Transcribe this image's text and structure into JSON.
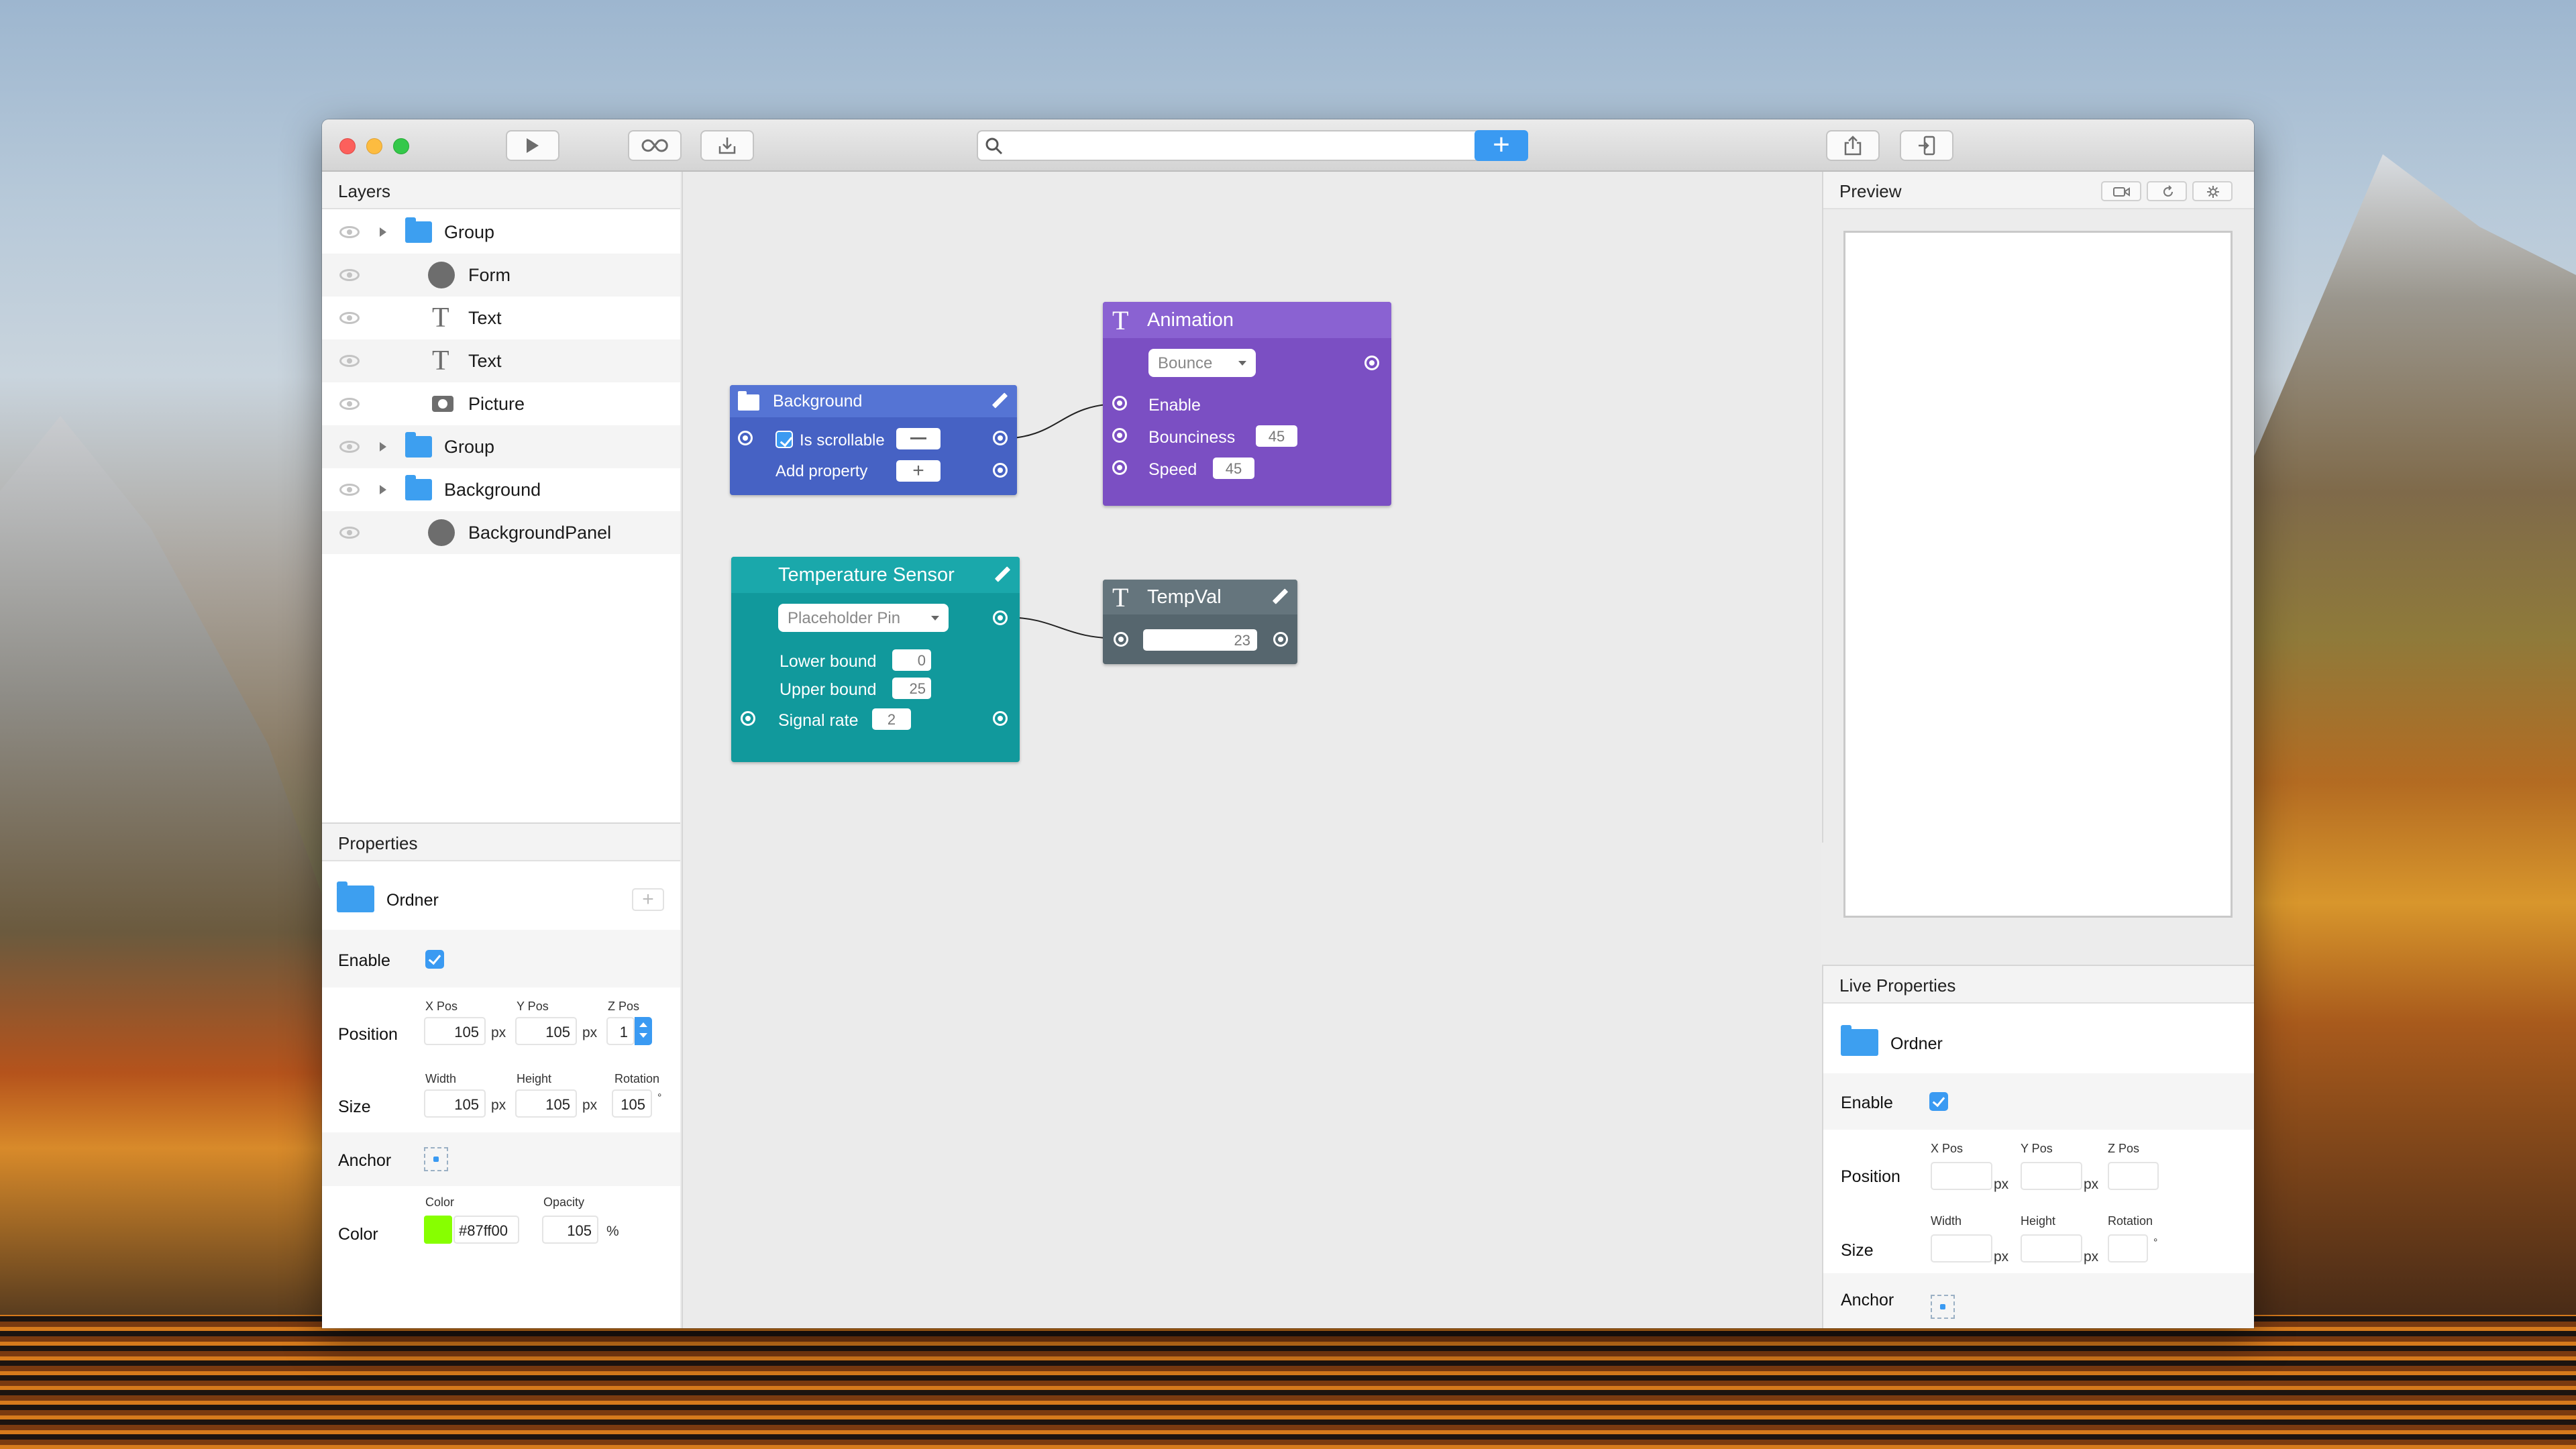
{
  "toolbar": {
    "play_icon": "play-icon",
    "loop_icon": "loop-icon",
    "import_icon": "import-icon",
    "search_placeholder": "",
    "add_icon": "plus-icon",
    "share_icon": "share-icon",
    "device_icon": "device-icon"
  },
  "layers": {
    "title": "Layers",
    "items": [
      {
        "label": "Group",
        "icon": "folder-icon"
      },
      {
        "label": "Form",
        "icon": "circle-icon"
      },
      {
        "label": "Text",
        "icon": "text-icon"
      },
      {
        "label": "Text",
        "icon": "text-icon"
      },
      {
        "label": "Picture",
        "icon": "camera-icon"
      },
      {
        "label": "Group",
        "icon": "folder-icon"
      },
      {
        "label": "Background",
        "icon": "folder-icon"
      },
      {
        "label": "BackgroundPanel",
        "icon": "circle-icon"
      }
    ]
  },
  "properties": {
    "title": "Properties",
    "object_name": "Ordner",
    "enable_label": "Enable",
    "position_label": "Position",
    "xpos_label": "X Pos",
    "ypos_label": "Y Pos",
    "zpos_label": "Z Pos",
    "xpos": "105",
    "ypos": "105",
    "zpos": "1",
    "px": "px",
    "size_label": "Size",
    "width_label": "Width",
    "height_label": "Height",
    "rotation_label": "Rotation",
    "width": "105",
    "height": "105",
    "rotation": "105",
    "deg": "°",
    "anchor_label": "Anchor",
    "color_label": "Color",
    "color_sub": "Color",
    "opacity_label": "Opacity",
    "color_value": "#87ff00",
    "opacity": "105",
    "percent": "%",
    "swatch": "#87ff00"
  },
  "nodes": {
    "background": {
      "title": "Background",
      "is_scrollable": "Is scrollable",
      "add_property": "Add property",
      "color": "#4662c4"
    },
    "animation": {
      "title": "Animation",
      "select": "Bounce",
      "enable": "Enable",
      "bounciness_label": "Bounciness",
      "bounciness": "45",
      "speed_label": "Speed",
      "speed": "45",
      "color": "#7b4fc3"
    },
    "temperature": {
      "title": "Temperature Sensor",
      "select": "Placeholder Pin",
      "lower_label": "Lower bound",
      "lower": "0",
      "upper_label": "Upper bound",
      "upper": "25",
      "rate_label": "Signal rate",
      "rate": "2",
      "color": "#11999c"
    },
    "tempval": {
      "title": "TempVal",
      "value": "23",
      "color": "#56666e"
    }
  },
  "preview": {
    "title": "Preview",
    "camera_icon": "video-icon",
    "reload_icon": "reload-icon",
    "settings_icon": "gear-icon"
  },
  "live": {
    "title": "Live Properties",
    "object_name": "Ordner",
    "enable_label": "Enable",
    "position_label": "Position",
    "xpos_label": "X Pos",
    "ypos_label": "Y Pos",
    "zpos_label": "Z Pos",
    "px": "px",
    "size_label": "Size",
    "width_label": "Width",
    "height_label": "Height",
    "rotation_label": "Rotation",
    "deg": "°",
    "anchor_label": "Anchor"
  }
}
